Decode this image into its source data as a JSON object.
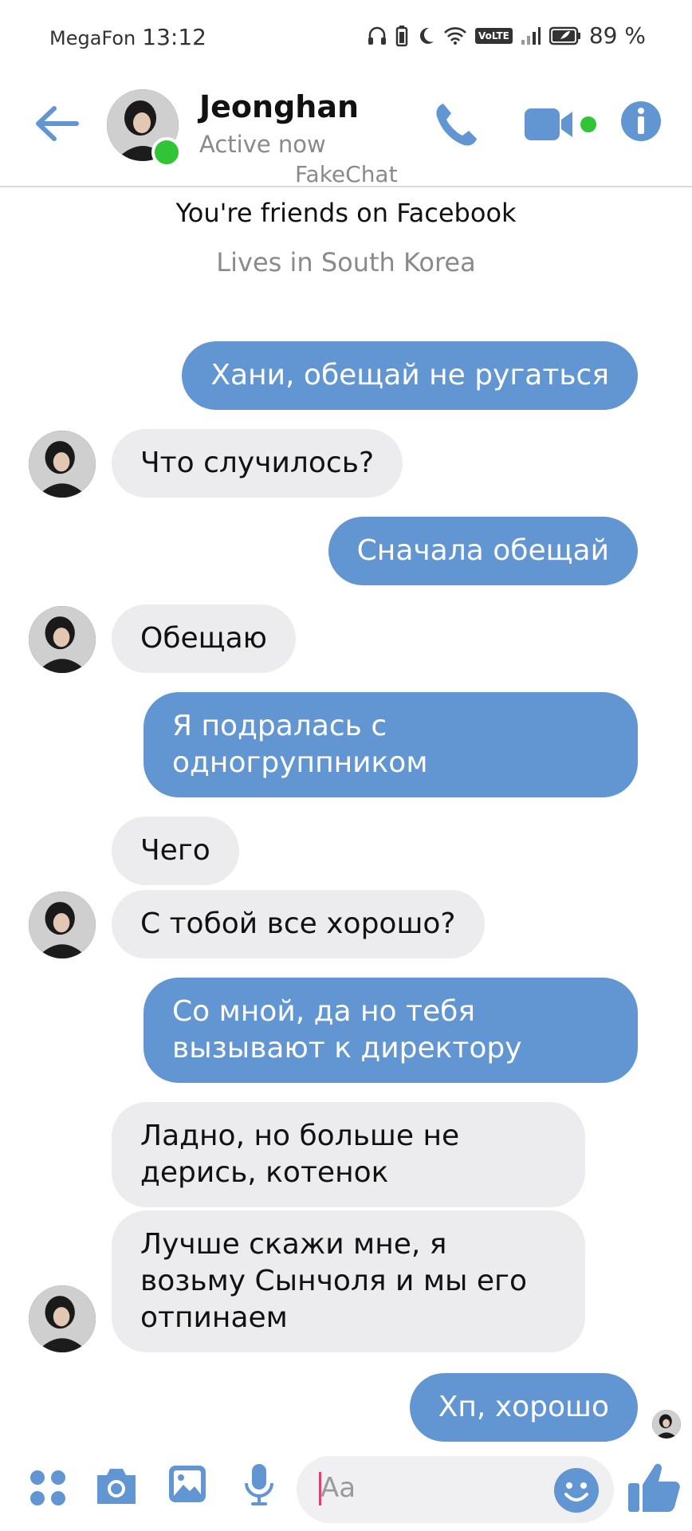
{
  "status_bar": {
    "carrier": "MegaFon",
    "time": "13:12",
    "volte": "VoLTE",
    "battery": "89 %"
  },
  "header": {
    "contact_name": "Jeonghan",
    "contact_status": "Active now",
    "watermark": "FakeChat",
    "icons": [
      "back-arrow-icon",
      "phone-icon",
      "video-camera-icon",
      "info-icon"
    ],
    "accent_color": "#6196d2",
    "online_color": "#31c436"
  },
  "intro": {
    "line1": "You're friends on Facebook",
    "line2": "Lives in South Korea"
  },
  "messages": [
    {
      "from": "me",
      "text": "Хани, обещай не ругаться"
    },
    {
      "from": "them",
      "text": "Что случилось?"
    },
    {
      "from": "me",
      "text": "Сначала обещай"
    },
    {
      "from": "them",
      "text": "Обещаю"
    },
    {
      "from": "me",
      "text": "Я подралась с одногруппником"
    },
    {
      "from": "them",
      "text": "Чего"
    },
    {
      "from": "them",
      "text": "С тобой все хорошо?"
    },
    {
      "from": "me",
      "text": "Со мной, да но тебя вызывают к директору"
    },
    {
      "from": "them",
      "text": "Ладно, но больше не дерись, котенок"
    },
    {
      "from": "them",
      "text": "Лучше скажи мне, я возьму Сынчоля и мы его отпинаем"
    },
    {
      "from": "me",
      "text": "Хп, хорошо"
    }
  ],
  "composer": {
    "placeholder": "Aa",
    "icons": [
      "apps-grid-icon",
      "camera-icon",
      "image-icon",
      "microphone-icon",
      "emoji-icon",
      "thumbs-up-icon"
    ]
  },
  "colors": {
    "outgoing_bubble": "#6196d2",
    "incoming_bubble": "#ececee"
  }
}
